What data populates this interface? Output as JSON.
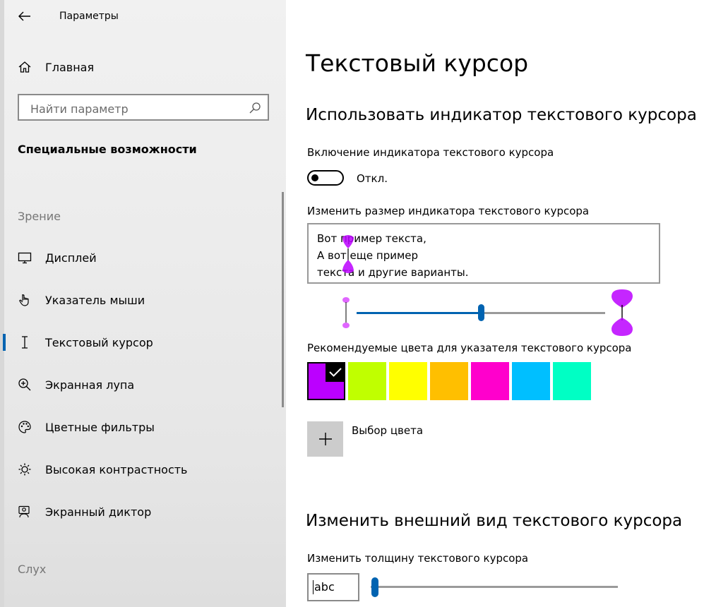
{
  "app": {
    "title": "Параметры"
  },
  "sidebar": {
    "home_label": "Главная",
    "search_placeholder": "Найти параметр",
    "section_title": "Специальные возможности",
    "group_vision": "Зрение",
    "group_hearing": "Слух",
    "items": [
      {
        "label": "Дисплей",
        "icon": "monitor-icon"
      },
      {
        "label": "Указатель мыши",
        "icon": "mouse-pointer-icon"
      },
      {
        "label": "Текстовый курсор",
        "icon": "text-cursor-icon",
        "active": true
      },
      {
        "label": "Экранная лупа",
        "icon": "magnifier-icon"
      },
      {
        "label": "Цветные фильтры",
        "icon": "palette-icon"
      },
      {
        "label": "Высокая контрастность",
        "icon": "brightness-icon"
      },
      {
        "label": "Экранный диктор",
        "icon": "narrator-icon"
      }
    ]
  },
  "main": {
    "page_title": "Текстовый курсор",
    "section1_title": "Использовать индикатор текстового курсора",
    "toggle_label": "Включение индикатора текстового курсора",
    "toggle_state": "Откл.",
    "toggle_on": false,
    "size_label": "Изменить размер индикатора текстового курсора",
    "preview_lines": [
      "Вот пример текста,",
      "А вот еще пример",
      "текста и другие варианты."
    ],
    "size_slider_fraction": 0.5,
    "colors_label": "Рекомендуемые цвета для указателя текстового курсора",
    "colors": [
      "#bb00ff",
      "#c0ff00",
      "#ffff00",
      "#ffbf00",
      "#ff00cc",
      "#00bfff",
      "#00ffc4"
    ],
    "selected_color": 0,
    "picker_label": "Выбор цвета",
    "section2_title": "Изменить внешний вид текстового курсора",
    "thickness_label": "Изменить толщину текстового курсора",
    "thickness_sample": "abc",
    "thickness_slider_fraction": 0.0,
    "accent": "#0063b1"
  }
}
